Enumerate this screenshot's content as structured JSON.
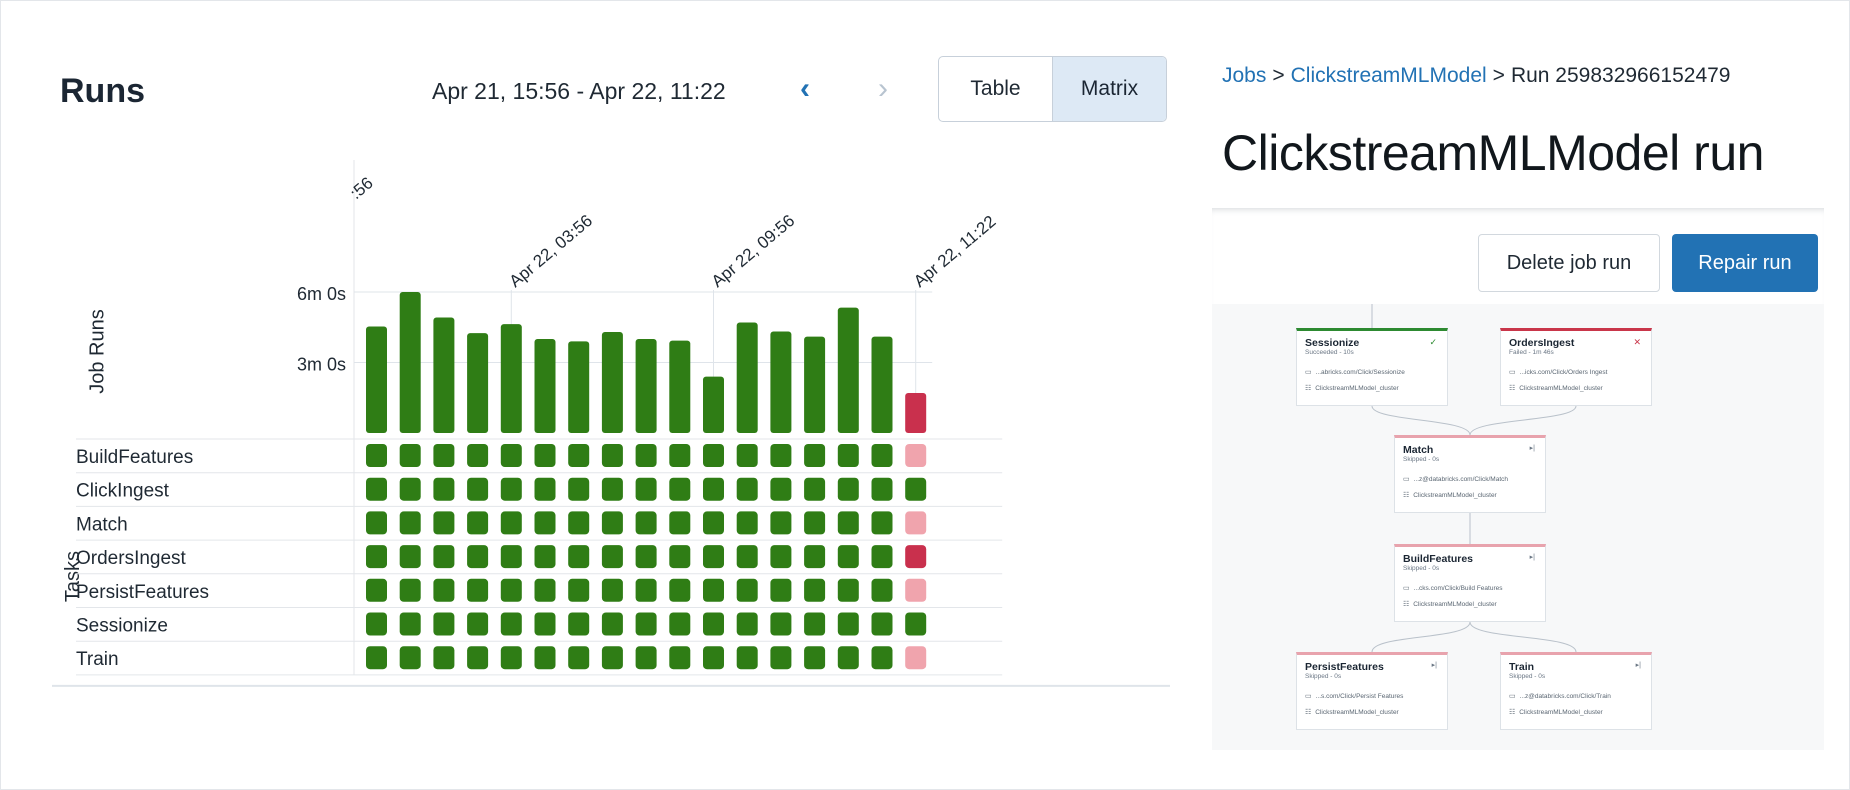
{
  "runs": {
    "title": "Runs",
    "date_range": "Apr 21, 15:56 - Apr 22, 11:22",
    "prev_icon": "chevron-left-icon",
    "next_icon": "chevron-right-icon",
    "view_toggle": {
      "table_label": "Table",
      "matrix_label": "Matrix",
      "active": "Matrix"
    }
  },
  "chart_data": {
    "type": "bar",
    "ylabel": "Job Runs",
    "y_ticks": [
      "6m 0s",
      "3m 0s"
    ],
    "y_tick_values_seconds": [
      360,
      180
    ],
    "x_tick_labels": [
      ":56",
      "Apr 22, 03:56",
      "Apr 22, 09:56",
      "Apr 22, 11:22"
    ],
    "x_tick_run_index": [
      0,
      4,
      10,
      16
    ],
    "run_durations_seconds": [
      272,
      360,
      295,
      255,
      278,
      240,
      234,
      258,
      240,
      236,
      144,
      282,
      259,
      246,
      320,
      246,
      102
    ],
    "run_status": [
      "success",
      "success",
      "success",
      "success",
      "success",
      "success",
      "success",
      "success",
      "success",
      "success",
      "success",
      "success",
      "success",
      "success",
      "success",
      "success",
      "failed"
    ],
    "colors": {
      "success": "#2f7d15",
      "failed": "#c9304d",
      "skipped": "#f0a4ad"
    }
  },
  "tasks": {
    "label": "Tasks",
    "rows": [
      {
        "name": "BuildFeatures",
        "last_status": "skipped"
      },
      {
        "name": "ClickIngest",
        "last_status": "success"
      },
      {
        "name": "Match",
        "last_status": "skipped"
      },
      {
        "name": "OrdersIngest",
        "last_status": "failed"
      },
      {
        "name": "PersistFeatures",
        "last_status": "skipped"
      },
      {
        "name": "Sessionize",
        "last_status": "success"
      },
      {
        "name": "Train",
        "last_status": "skipped"
      }
    ]
  },
  "detail": {
    "breadcrumb": {
      "jobs": "Jobs",
      "job": "ClickstreamMLModel",
      "run": "Run 259832966152479",
      "separator": ">"
    },
    "title": "ClickstreamMLModel run",
    "delete_label": "Delete job run",
    "repair_label": "Repair run",
    "dag_nodes": [
      {
        "name": "Sessionize",
        "status": "Succeeded - 10s",
        "path": "...abricks.com/Click/Sessionize",
        "cluster": "ClickstreamMLModel_cluster",
        "state": "ok"
      },
      {
        "name": "OrdersIngest",
        "status": "Failed - 1m 46s",
        "path": "...icks.com/Click/Orders Ingest",
        "cluster": "ClickstreamMLModel_cluster",
        "state": "fail"
      },
      {
        "name": "Match",
        "status": "Skipped - 0s",
        "path": "...z@databricks.com/Click/Match",
        "cluster": "ClickstreamMLModel_cluster",
        "state": "skip"
      },
      {
        "name": "BuildFeatures",
        "status": "Skipped - 0s",
        "path": "...cks.com/Click/Build Features",
        "cluster": "ClickstreamMLModel_cluster",
        "state": "skip"
      },
      {
        "name": "PersistFeatures",
        "status": "Skipped - 0s",
        "path": "...s.com/Click/Persist Features",
        "cluster": "ClickstreamMLModel_cluster",
        "state": "skip"
      },
      {
        "name": "Train",
        "status": "Skipped - 0s",
        "path": "...z@databricks.com/Click/Train",
        "cluster": "ClickstreamMLModel_cluster",
        "state": "skip"
      }
    ]
  }
}
